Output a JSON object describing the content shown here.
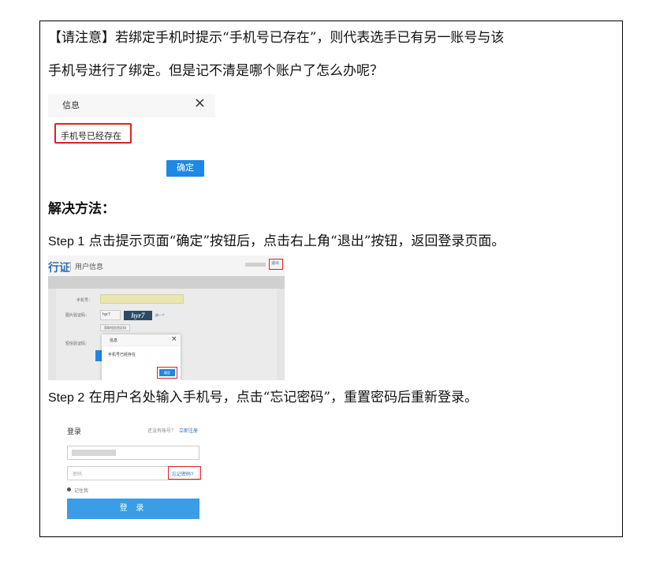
{
  "notice": {
    "line1": "【请注意】若绑定手机时提示“手机号已存在”，则代表选手已有另一账号与该",
    "line2": "手机号进行了绑定。但是记不清是哪个账户了怎么办呢？"
  },
  "dialog1": {
    "title": "信息",
    "close": "×",
    "message": "手机号已经存在",
    "ok": "确定"
  },
  "solution_title": "解决方法：",
  "step1": {
    "label": "Step 1",
    "text": "点击提示页面“确定”按钮后，点击右上角“退出”按钮，返回登录页面。"
  },
  "screenshot2": {
    "brand": "行证",
    "crumb": "用户信息",
    "logout": "退出",
    "phone_label": "手机号：",
    "captcha_label": "图片验证码：",
    "captcha_value": "hyr7",
    "captcha_image": "hyr7",
    "refresh": "换一个",
    "sms_button": "获取短信验证码",
    "sms_label": "短信验证码：",
    "dialog_title": "信息",
    "dialog_close": "×",
    "dialog_msg": "手机号已经存在",
    "dialog_ok": "确定"
  },
  "step2": {
    "label": "Step 2",
    "text": "在用户名处输入手机号，点击“忘记密码”，重置密码后重新登录。"
  },
  "login": {
    "title": "登录",
    "register_q": "还没有账号？",
    "register_link": "立即注册",
    "password_placeholder": "密码",
    "forgot": "忘记密码?",
    "remember": "记住我",
    "submit": "登 录"
  },
  "colors": {
    "highlight_red": "#e02020",
    "primary_blue": "#1e88e5",
    "link_blue": "#2b6fb3"
  }
}
